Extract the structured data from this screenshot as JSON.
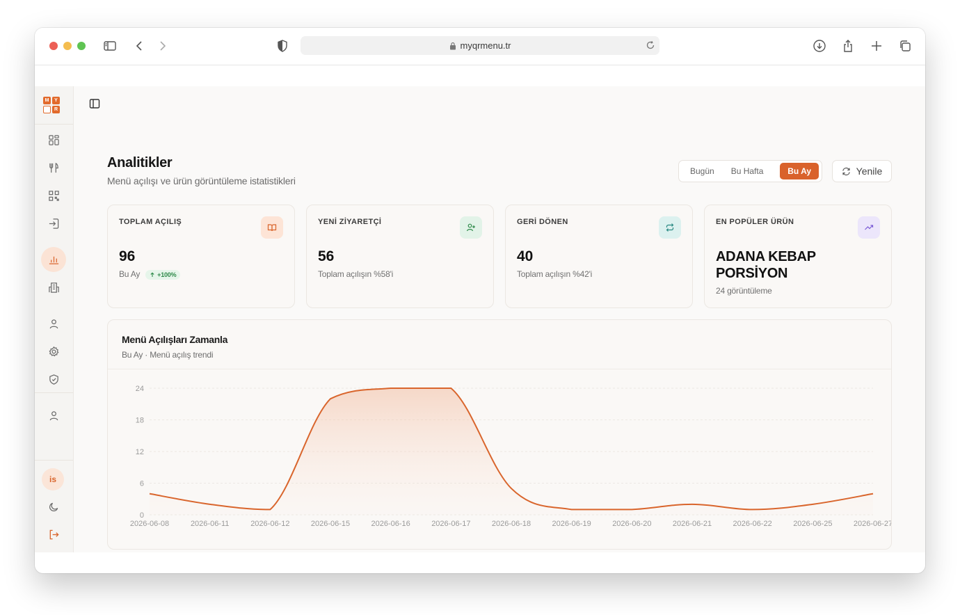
{
  "browser": {
    "url": "myqrmenu.tr"
  },
  "sidebar": {
    "logo": [
      "M",
      "Y",
      "",
      "R"
    ],
    "items": [
      {
        "icon": "dashboard-icon"
      },
      {
        "icon": "menu-utensils-icon"
      },
      {
        "icon": "qr-code-icon"
      },
      {
        "icon": "import-icon"
      },
      {
        "icon": "analytics-chart-icon",
        "active": true
      },
      {
        "icon": "building-icon"
      },
      {
        "icon": "user-icon"
      },
      {
        "icon": "settings-gear-icon"
      },
      {
        "icon": "shield-icon"
      },
      {
        "icon": "profile-icon"
      }
    ],
    "avatar_initials": "is",
    "bottom": [
      {
        "icon": "moon-icon"
      },
      {
        "icon": "logout-icon"
      }
    ]
  },
  "header": {
    "title": "Analitikler",
    "subtitle": "Menü açılışı ve ürün görüntüleme istatistikleri",
    "ranges": [
      "Bugün",
      "Bu Hafta",
      "Bu Ay"
    ],
    "active_range": "Bu Ay",
    "refresh_label": "Yenile"
  },
  "cards": [
    {
      "label": "TOPLAM AÇILIŞ",
      "value": "96",
      "sub": "Bu Ay",
      "badge": "+100%",
      "icon": "book-open-icon",
      "icon_bg": "#fde4d6",
      "icon_color": "#d9652c"
    },
    {
      "label": "YENİ ZİYARETÇİ",
      "value": "56",
      "sub": "Toplam açılışın %58'i",
      "icon": "user-plus-icon",
      "icon_bg": "#e2f3e8",
      "icon_color": "#2f8a4a"
    },
    {
      "label": "GERİ DÖNEN",
      "value": "40",
      "sub": "Toplam açılışın %42'i",
      "icon": "repeat-icon",
      "icon_bg": "#dcf1ef",
      "icon_color": "#2a8a83"
    },
    {
      "label": "EN POPÜLER ÜRÜN",
      "value": "ADANA KEBAP PORSİYON",
      "sub": "24 görüntüleme",
      "icon": "trending-up-icon",
      "icon_bg": "#ece6fb",
      "icon_color": "#7a5ad6"
    }
  ],
  "chart_section": {
    "title": "Menü Açılışları Zamanla",
    "subtitle": "Bu Ay · Menü açılış trendi"
  },
  "chart_data": {
    "type": "area",
    "x": [
      "2026-06-08",
      "2026-06-11",
      "2026-06-12",
      "2026-06-15",
      "2026-06-16",
      "2026-06-17",
      "2026-06-18",
      "2026-06-19",
      "2026-06-20",
      "2026-06-21",
      "2026-06-22",
      "2026-06-25",
      "2026-06-27"
    ],
    "values": [
      4,
      2,
      1,
      22,
      24,
      24,
      5,
      1,
      1,
      2,
      1,
      2,
      4
    ],
    "ylim": [
      0,
      24
    ],
    "yticks": [
      0,
      6,
      12,
      18,
      24
    ],
    "color": "#d9652c",
    "grid": true
  }
}
